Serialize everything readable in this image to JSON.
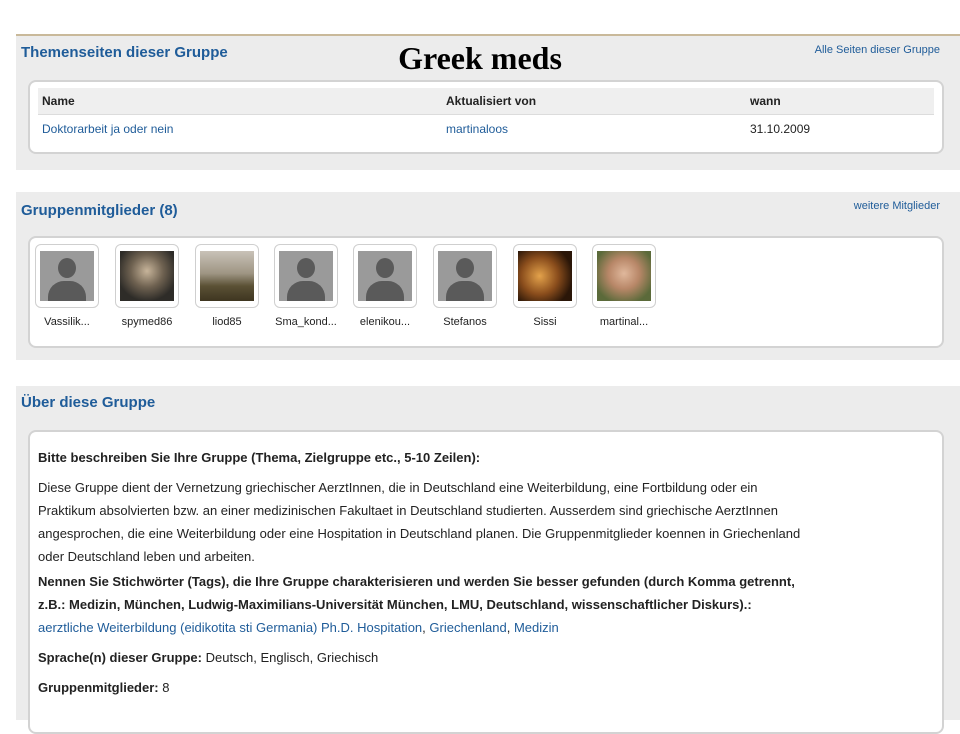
{
  "overlay_title": "Greek meds",
  "themenseiten": {
    "title": "Themenseiten dieser Gruppe",
    "link": "Alle Seiten dieser Gruppe",
    "columns": [
      "Name",
      "Aktualisiert von",
      "wann"
    ],
    "rows": [
      {
        "name": "Doktorarbeit ja oder nein",
        "by": "martinaloos",
        "date": "31.10.2009"
      }
    ]
  },
  "members": {
    "title": "Gruppenmitglieder (8)",
    "link": "weitere Mitglieder",
    "items": [
      {
        "name": "Vassilik...",
        "avatar": "default-avatar-icon"
      },
      {
        "name": "spymed86",
        "avatar": "photo"
      },
      {
        "name": "liod85",
        "avatar": "photo"
      },
      {
        "name": "Sma_kond...",
        "avatar": "default-avatar-icon"
      },
      {
        "name": "elenikou...",
        "avatar": "default-avatar-icon"
      },
      {
        "name": "Stefanos",
        "avatar": "default-avatar-icon"
      },
      {
        "name": "Sissi",
        "avatar": "photo"
      },
      {
        "name": "martinal...",
        "avatar": "photo"
      }
    ]
  },
  "about": {
    "title": "Über diese Gruppe",
    "describe_label": "Bitte beschreiben Sie Ihre Gruppe (Thema, Zielgruppe etc., 5-10 Zeilen):",
    "describe_lines": [
      "Diese Gruppe dient der Vernetzung griechischer AerztInnen, die in Deutschland eine Weiterbildung, eine Fortbildung oder ein",
      "Praktikum absolvierten bzw. an einer medizinischen Fakultaet in Deutschland studierten. Ausserdem sind griechische AerztInnen",
      "angesprochen, die eine Weiterbildung oder eine Hospitation in Deutschland planen. Die Gruppenmitglieder koennen in Griechenland",
      "oder Deutschland leben und arbeiten."
    ],
    "tags_label_line1": "Nennen Sie Stichwörter (Tags), die Ihre Gruppe charakterisieren und werden Sie besser gefunden (durch Komma getrennt,",
    "tags_label_line2": "z.B.: Medizin, München, Ludwig-Maximilians-Universität München, LMU, Deutschland, wissenschaftlicher Diskurs).:",
    "tags": [
      "aerztliche Weiterbildung (eidikotita sti Germania) Ph.D. Hospitation",
      "Griechenland",
      "Medizin"
    ],
    "tag_separator": ", ",
    "language_label": "Sprache(n) dieser Gruppe:",
    "language_value": " Deutsch, Englisch, Griechisch",
    "members_label": "Gruppenmitglieder:",
    "members_value": " 8"
  }
}
